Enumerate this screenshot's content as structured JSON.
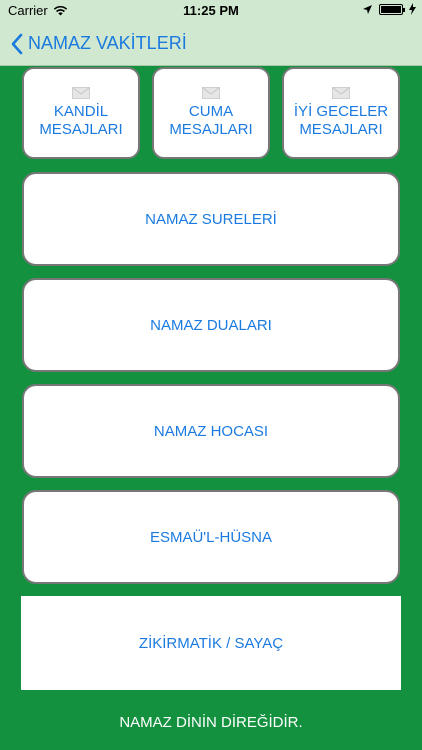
{
  "status_bar": {
    "carrier": "Carrier",
    "time": "11:25 PM"
  },
  "nav": {
    "back_label": "NAMAZ VAKİTLERİ"
  },
  "top_cards": [
    {
      "line1": "KANDİL",
      "line2": "MESAJLARI",
      "icon": "envelope-icon"
    },
    {
      "line1": "CUMA",
      "line2": "MESAJLARI",
      "icon": "envelope-icon"
    },
    {
      "line1": "İYİ GECELER",
      "line2": "MESAJLARI",
      "icon": "envelope-icon"
    }
  ],
  "menu_buttons": [
    {
      "label": "NAMAZ SURELERİ"
    },
    {
      "label": "NAMAZ DUALARI"
    },
    {
      "label": "NAMAZ HOCASI"
    },
    {
      "label": "ESMAÜ'L-HÜSNA"
    },
    {
      "label": "ZİKİRMATİK / SAYAÇ"
    }
  ],
  "footer": {
    "text": "NAMAZ DİNİN DİREĞİDİR."
  },
  "colors": {
    "background": "#13913f",
    "nav_background": "#cfe8cf",
    "link_blue": "#1a7adf"
  }
}
